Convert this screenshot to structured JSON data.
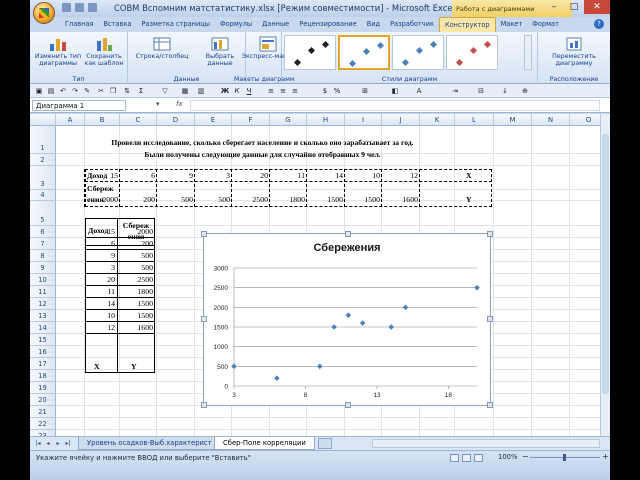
{
  "window": {
    "title": "СОВМ Вспомним матстатистику.xlsx  [Режим совместимости] - Microsoft Excel",
    "context_tab_title": "Работа с диаграммами"
  },
  "tabs": [
    "Главная",
    "Вставка",
    "Разметка страницы",
    "Формулы",
    "Данные",
    "Рецензирование",
    "Вид",
    "Разработчик",
    "Конструктор",
    "Макет",
    "Формат"
  ],
  "active_tab": "Конструктор",
  "ribbon": {
    "groups": {
      "type": "Тип",
      "data": "Данные",
      "layouts": "Макеты диаграмм",
      "styles": "Стили диаграмм",
      "location": "Расположение"
    },
    "buttons": {
      "change_type": "Изменить тип\nдиаграммы",
      "save_template": "Сохранить\nкак шаблон",
      "switch_rowcol": "Строка/столбец",
      "select_data": "Выбрать\nданные",
      "quick_layout": "Экспресс-макет",
      "move_chart": "Переместить\nдиаграмму"
    }
  },
  "name_box": "Диаграмма 1",
  "formula_fx": "fx",
  "columns": [
    "A",
    "B",
    "C",
    "D",
    "E",
    "F",
    "G",
    "H",
    "I",
    "J",
    "K",
    "L",
    "M",
    "N",
    "O"
  ],
  "rows": [
    "1",
    "2",
    "3",
    "4",
    "5",
    "6",
    "7",
    "8",
    "9",
    "10",
    "11",
    "12",
    "13",
    "14",
    "15",
    "16",
    "17",
    "18",
    "19",
    "20",
    "21",
    "22",
    "23",
    "24",
    "25"
  ],
  "sheet": {
    "heading_line1": "Провели исследование, сколько сберегает население и сколько оно зарабатывает за год.",
    "heading_line2": "Были получены следующие данные для случайно отобранных 9 чел.",
    "row2_label": "Доход",
    "row2_values": [
      "15",
      "6",
      "9",
      "3",
      "20",
      "11",
      "14",
      "10",
      "12"
    ],
    "row2_end": "X",
    "row3_label_line1": "Сбереж",
    "row3_label_line2": "ения",
    "row3_values": [
      "2000",
      "200",
      "500",
      "500",
      "2500",
      "1800",
      "1500",
      "1500",
      "1600"
    ],
    "row3_end": "Y",
    "table_header_a": "Доход",
    "table_header_b_line1": "Сбереж",
    "table_header_b_line2": "ения",
    "table_rows": [
      [
        "15",
        "2000"
      ],
      [
        "6",
        "200"
      ],
      [
        "9",
        "500"
      ],
      [
        "3",
        "500"
      ],
      [
        "20",
        "2500"
      ],
      [
        "11",
        "1800"
      ],
      [
        "14",
        "1500"
      ],
      [
        "10",
        "1500"
      ],
      [
        "12",
        "1600"
      ]
    ],
    "table_footer": [
      "X",
      "Y"
    ]
  },
  "chart_data": {
    "type": "scatter",
    "title": "Сбережения",
    "series": [
      {
        "points": [
          [
            15,
            2000
          ],
          [
            6,
            200
          ],
          [
            9,
            500
          ],
          [
            3,
            500
          ],
          [
            20,
            2500
          ],
          [
            11,
            1800
          ],
          [
            14,
            1500
          ],
          [
            10,
            1500
          ],
          [
            12,
            1600
          ]
        ]
      }
    ],
    "x_ticks": [
      3,
      8,
      13,
      18
    ],
    "y_ticks": [
      0,
      500,
      1000,
      1500,
      2000,
      2500,
      3000
    ],
    "xlim": [
      3,
      20
    ],
    "ylim": [
      0,
      3000
    ],
    "grid": "horizontal",
    "legend": "none",
    "marker_color": "#4f81bd"
  },
  "sheet_tabs": [
    "Уровень осадков-Выб.характерист",
    "Сбер-Поле корреляции"
  ],
  "active_sheet_tab": "Сбер-Поле корреляции",
  "status_text": "Укажите ячейку и нажмите ВВОД или выберите \"Вставить\"",
  "zoom": "100%",
  "colors": {
    "ribbon_bg": "#dbe7f5",
    "tab_active": "#fbe7a5",
    "context_bg": "#f1cf63",
    "marker": "#4f81bd"
  }
}
